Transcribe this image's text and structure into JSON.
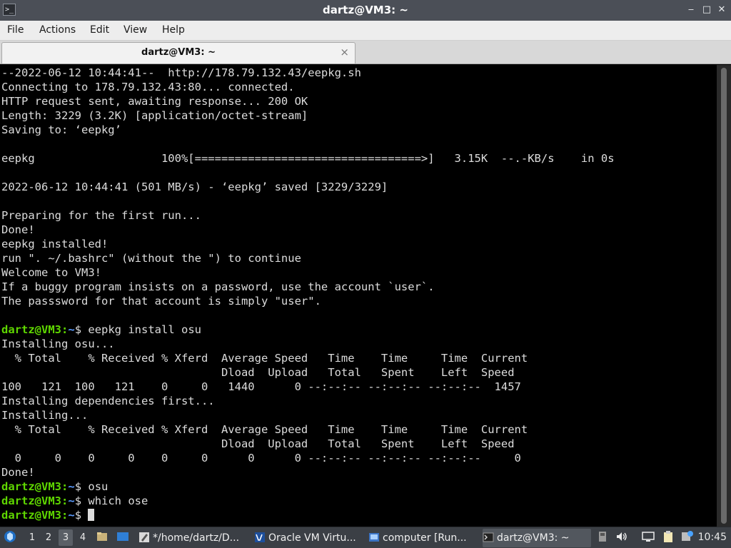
{
  "window": {
    "title": "dartz@VM3: ~",
    "minimize_glyph": "‒",
    "maximize_glyph": "□",
    "close_glyph": "✕"
  },
  "menu": {
    "items": [
      "File",
      "Actions",
      "Edit",
      "View",
      "Help"
    ]
  },
  "tab": {
    "label": "dartz@VM3: ~",
    "close_glyph": "×"
  },
  "terminal": {
    "prompt_user": "dartz@VM3",
    "prompt_path": "~",
    "lines": [
      {
        "text": "--2022-06-12 10:44:41--  http://178.79.132.43/eepkg.sh"
      },
      {
        "text": "Connecting to 178.79.132.43:80... connected."
      },
      {
        "text": "HTTP request sent, awaiting response... 200 OK"
      },
      {
        "text": "Length: 3229 (3.2K) [application/octet-stream]"
      },
      {
        "text": "Saving to: ‘eepkg’"
      },
      {
        "text": ""
      },
      {
        "text": "eepkg                   100%[==================================>]   3.15K  --.-KB/s    in 0s"
      },
      {
        "text": ""
      },
      {
        "text": "2022-06-12 10:44:41 (501 MB/s) - ‘eepkg’ saved [3229/3229]"
      },
      {
        "text": ""
      },
      {
        "text": "Preparing for the first run..."
      },
      {
        "text": "Done!"
      },
      {
        "text": "eepkg installed!"
      },
      {
        "text": "run \". ~/.bashrc\" (without the \") to continue"
      },
      {
        "text": "Welcome to VM3!"
      },
      {
        "text": "If a buggy program insists on a password, use the account `user`."
      },
      {
        "text": "The passsword for that account is simply \"user\"."
      },
      {
        "text": ""
      },
      {
        "prompt": true,
        "text": "eepkg install osu"
      },
      {
        "text": "Installing osu..."
      },
      {
        "text": "  % Total    % Received % Xferd  Average Speed   Time    Time     Time  Current"
      },
      {
        "text": "                                 Dload  Upload   Total   Spent    Left  Speed"
      },
      {
        "text": "100   121  100   121    0     0   1440      0 --:--:-- --:--:-- --:--:--  1457"
      },
      {
        "text": "Installing dependencies first..."
      },
      {
        "text": "Installing..."
      },
      {
        "text": "  % Total    % Received % Xferd  Average Speed   Time    Time     Time  Current"
      },
      {
        "text": "                                 Dload  Upload   Total   Spent    Left  Speed"
      },
      {
        "text": "  0     0    0     0    0     0      0      0 --:--:-- --:--:-- --:--:--     0"
      },
      {
        "text": "Done!"
      },
      {
        "prompt": true,
        "text": "osu"
      },
      {
        "prompt": true,
        "text": "which ose"
      },
      {
        "prompt": true,
        "text": "",
        "cursor": true
      }
    ]
  },
  "taskbar": {
    "workspaces": [
      "1",
      "2",
      "3",
      "4"
    ],
    "active_workspace": "3",
    "tasks": [
      {
        "label": "*/home/dartz/D...",
        "icon": "text-editor-icon"
      },
      {
        "label": "Oracle VM Virtu...",
        "icon": "virtualbox-icon"
      },
      {
        "label": "computer [Run...",
        "icon": "virtualbox-vm-icon"
      },
      {
        "label": "dartz@VM3: ~",
        "icon": "terminal-icon",
        "active": true
      }
    ],
    "clock": "10:45"
  }
}
